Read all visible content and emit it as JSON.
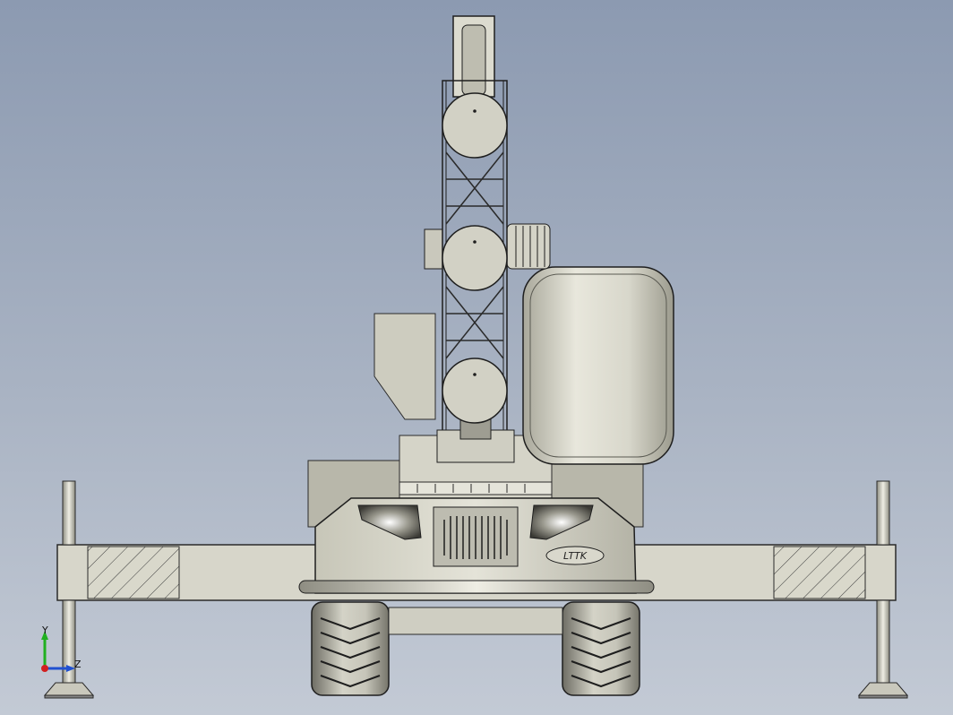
{
  "viewport": {
    "background_top": "#8c9ab1",
    "background_bottom": "#c3cad5"
  },
  "model": {
    "emblem_text": "LTTK"
  },
  "triad": {
    "y_label": "Y",
    "z_label": "Z",
    "x_color": "#d22020",
    "y_color": "#20b020",
    "z_color": "#2050d0"
  }
}
